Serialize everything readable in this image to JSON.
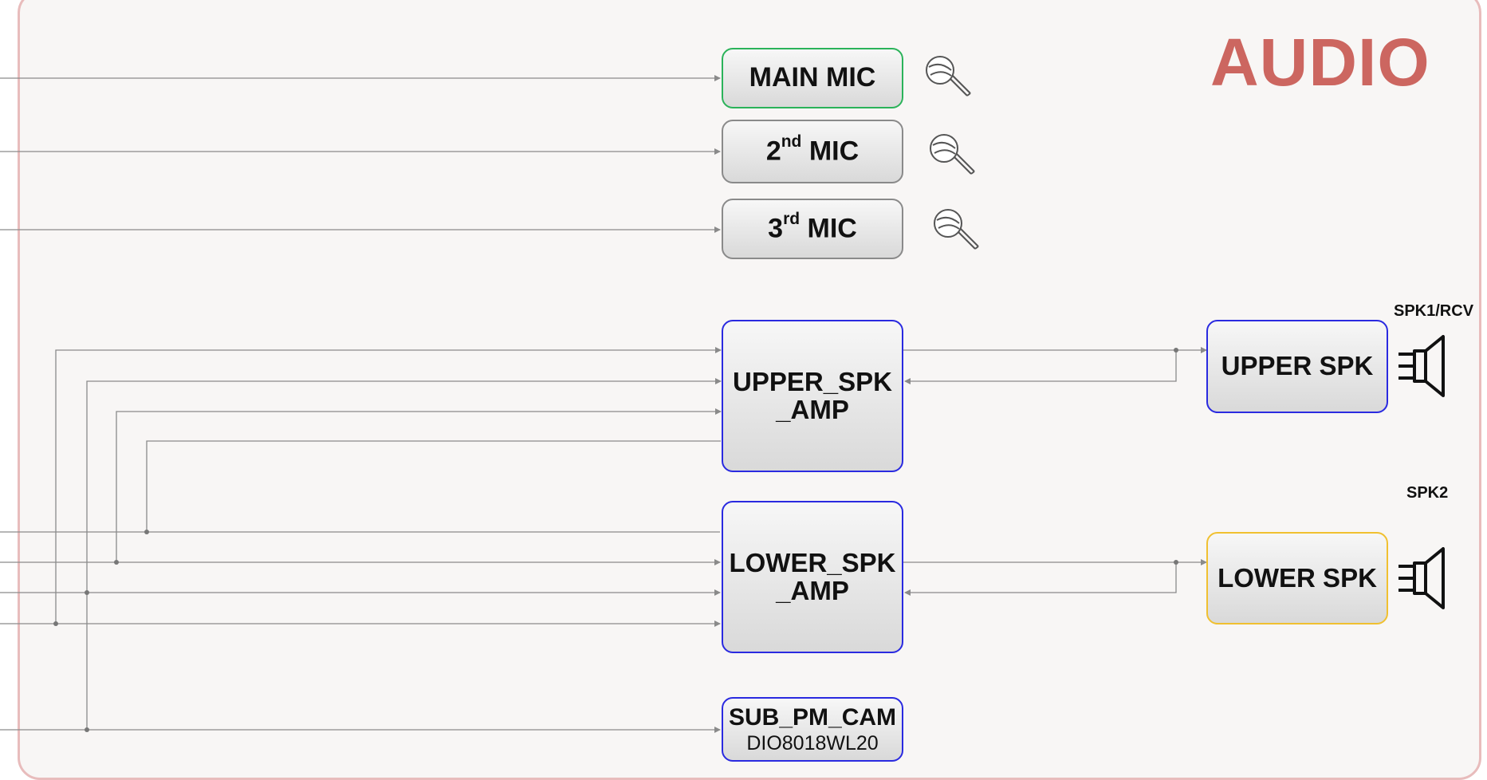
{
  "title": "AUDIO",
  "blocks": {
    "main_mic": {
      "label": "MAIN MIC"
    },
    "mic2": {
      "prefix": "2",
      "suffix": "nd",
      "label": "MIC"
    },
    "mic3": {
      "prefix": "3",
      "suffix": "rd",
      "label": "MIC"
    },
    "upper_amp": {
      "line1": "UPPER_SPK",
      "line2": "_AMP"
    },
    "lower_amp": {
      "line1": "LOWER_SPK",
      "line2": "_AMP"
    },
    "sub_pm_cam": {
      "title": "SUB_PM_CAM",
      "part": "DIO8018WL20"
    },
    "upper_spk": {
      "label": "UPPER SPK"
    },
    "lower_spk": {
      "label": "LOWER SPK"
    }
  },
  "labels": {
    "spk1": "SPK1/RCV",
    "spk2": "SPK2"
  },
  "icons": {
    "mics": [
      "microphone-icon",
      "microphone-icon",
      "microphone-icon"
    ],
    "speakers": [
      "speaker-icon",
      "speaker-icon"
    ]
  },
  "colors": {
    "title": "#cc6660",
    "main_mic_border": "#2bb35a",
    "amp_border": "#2a2ae0",
    "lower_spk_border": "#f0c030",
    "panel_border": "#e8bcbc",
    "wire": "#8a8a8a"
  }
}
